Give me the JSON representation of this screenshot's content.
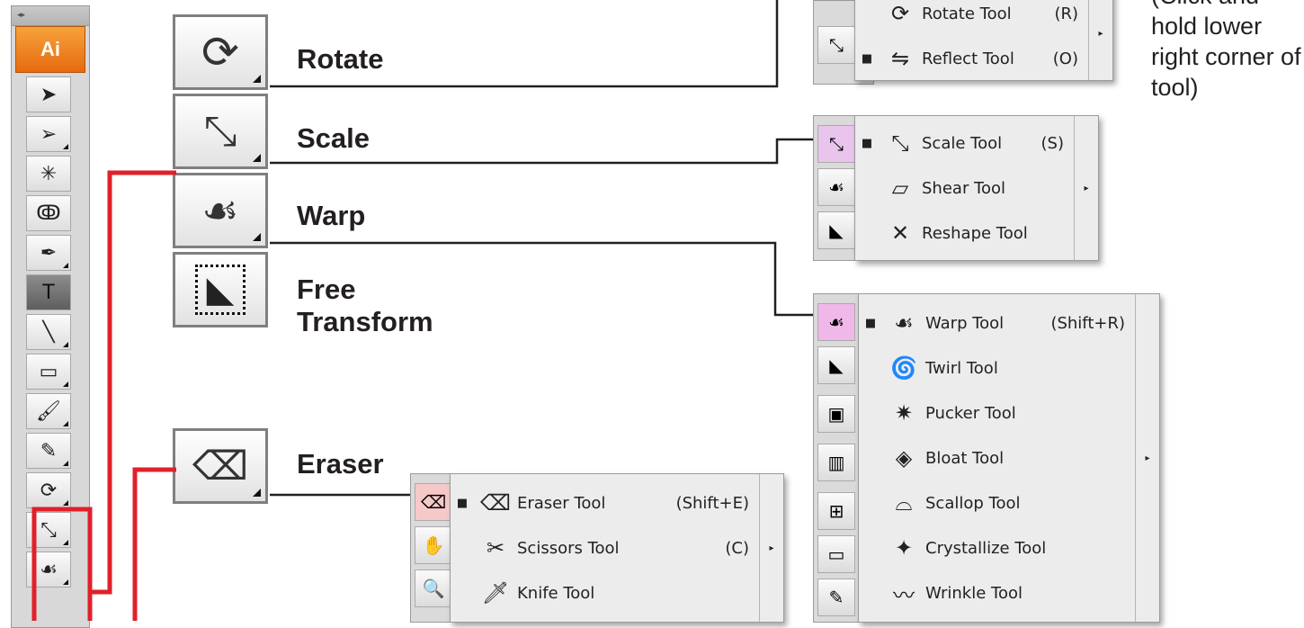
{
  "toolbar": {
    "logo": "Ai",
    "tools": [
      {
        "icon": "selection-arrow-icon",
        "glyph": "➤"
      },
      {
        "icon": "direct-selection-icon",
        "glyph": "➢"
      },
      {
        "icon": "magic-wand-icon",
        "glyph": "✳"
      },
      {
        "icon": "lasso-icon",
        "glyph": "ↂ"
      },
      {
        "icon": "pen-icon",
        "glyph": "✒"
      },
      {
        "icon": "type-icon",
        "glyph": "T"
      },
      {
        "icon": "line-segment-icon",
        "glyph": "╲"
      },
      {
        "icon": "rectangle-icon",
        "glyph": "▭"
      },
      {
        "icon": "paintbrush-icon",
        "glyph": "🖌"
      },
      {
        "icon": "pencil-icon",
        "glyph": "✎"
      },
      {
        "icon": "rotate-icon",
        "glyph": "⟳"
      },
      {
        "icon": "scale-icon",
        "glyph": "⤡"
      },
      {
        "icon": "warp-icon",
        "glyph": "☙"
      }
    ]
  },
  "tools": {
    "rotate": {
      "label": "Rotate",
      "glyph": "⟳"
    },
    "scale": {
      "label": "Scale",
      "glyph": "⤡"
    },
    "warp": {
      "label": "Warp",
      "glyph": "☙"
    },
    "free_transform": {
      "label": "Free\nTransform",
      "line1": "Free",
      "line2": "Transform",
      "glyph": "◣"
    },
    "eraser": {
      "label": "Eraser",
      "glyph": "⌫"
    }
  },
  "note": "(Click and hold lower right corner of tool)",
  "menus": {
    "rotate": [
      {
        "name": "Rotate Tool",
        "key": "(R)",
        "checked": false,
        "icon": "rotate-icon",
        "glyph": "⟳"
      },
      {
        "name": "Reflect Tool",
        "key": "(O)",
        "checked": true,
        "icon": "reflect-icon",
        "glyph": "⇋"
      }
    ],
    "scale": [
      {
        "name": "Scale Tool",
        "key": "(S)",
        "checked": true,
        "icon": "scale-icon",
        "glyph": "⤡"
      },
      {
        "name": "Shear Tool",
        "key": "",
        "checked": false,
        "icon": "shear-icon",
        "glyph": "▱"
      },
      {
        "name": "Reshape Tool",
        "key": "",
        "checked": false,
        "icon": "reshape-icon",
        "glyph": "✕"
      }
    ],
    "warp": [
      {
        "name": "Warp Tool",
        "key": "(Shift+R)",
        "checked": true,
        "icon": "warp-icon",
        "glyph": "☙"
      },
      {
        "name": "Twirl Tool",
        "key": "",
        "checked": false,
        "icon": "twirl-icon",
        "glyph": "🌀"
      },
      {
        "name": "Pucker Tool",
        "key": "",
        "checked": false,
        "icon": "pucker-icon",
        "glyph": "✷"
      },
      {
        "name": "Bloat Tool",
        "key": "",
        "checked": false,
        "icon": "bloat-icon",
        "glyph": "◈"
      },
      {
        "name": "Scallop Tool",
        "key": "",
        "checked": false,
        "icon": "scallop-icon",
        "glyph": "⌓"
      },
      {
        "name": "Crystallize Tool",
        "key": "",
        "checked": false,
        "icon": "crystallize-icon",
        "glyph": "✦"
      },
      {
        "name": "Wrinkle Tool",
        "key": "",
        "checked": false,
        "icon": "wrinkle-icon",
        "glyph": "〰"
      }
    ],
    "eraser": [
      {
        "name": "Eraser Tool",
        "key": "(Shift+E)",
        "checked": true,
        "icon": "eraser-icon",
        "glyph": "⌫"
      },
      {
        "name": "Scissors Tool",
        "key": "(C)",
        "checked": false,
        "icon": "scissors-icon",
        "glyph": "✂"
      },
      {
        "name": "Knife Tool",
        "key": "",
        "checked": false,
        "icon": "knife-icon",
        "glyph": "🗡"
      }
    ]
  },
  "colors": {
    "highlight_red": "#e0202a",
    "connector": "#231f20",
    "ai_orange": "#f08a24"
  }
}
